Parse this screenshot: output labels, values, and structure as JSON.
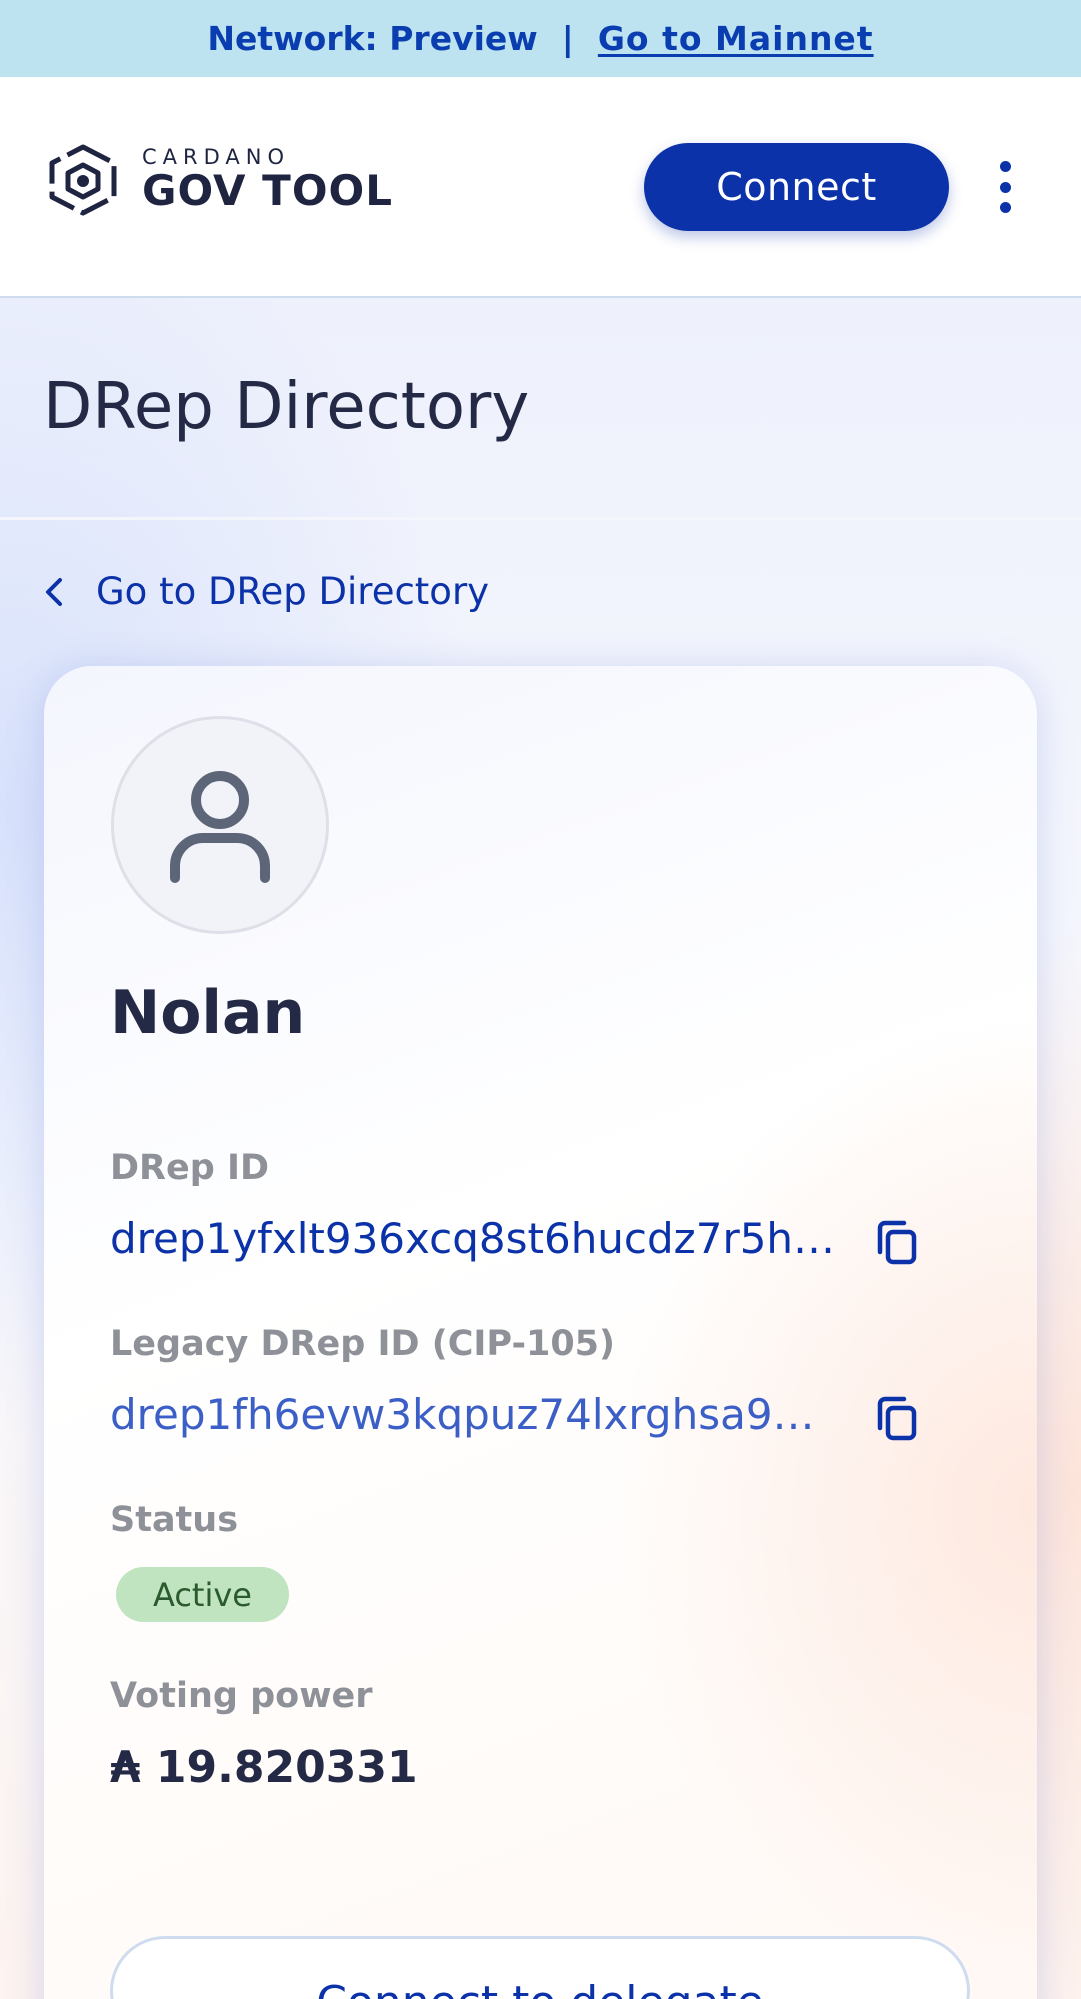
{
  "banner": {
    "network_text": "Network: Preview",
    "separator": "|",
    "mainnet_link": "Go to Mainnet"
  },
  "header": {
    "logo_small": "CARDANO",
    "logo_big": "GOV TOOL",
    "connect_label": "Connect",
    "menu_icon": "kebab-menu-icon"
  },
  "page": {
    "title": "DRep Directory",
    "back_link": "Go to DRep Directory"
  },
  "drep": {
    "name": "Nolan",
    "id_label": "DRep ID",
    "id_value": "drep1yfxlt936xcq8st6hucdz7r5h…",
    "legacy_label": "Legacy DRep ID (CIP-105)",
    "legacy_value": "drep1fh6evw3kqpuz74lxrghsa9…",
    "status_label": "Status",
    "status_value": "Active",
    "voting_label": "Voting power",
    "voting_value": "₳ 19.820331",
    "delegate_label": "Connect to delegate"
  },
  "colors": {
    "primary": "#0b32a8",
    "banner_bg": "#bde3f0",
    "status_bg": "#c0e4bf",
    "status_text": "#2b5a2e",
    "legacy_link": "#3b5fc7"
  }
}
